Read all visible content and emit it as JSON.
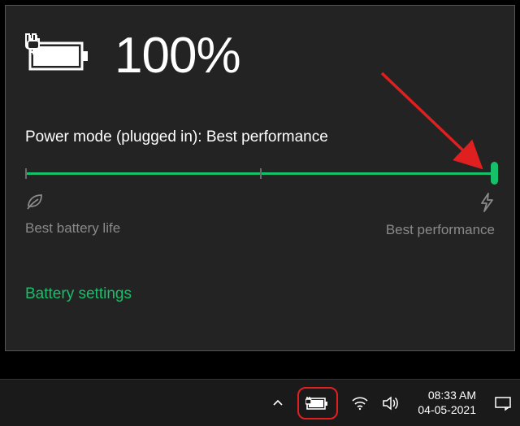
{
  "battery": {
    "percent": "100%",
    "mode_label": "Power mode (plugged in): Best performance",
    "left_label": "Best battery life",
    "right_label": "Best performance",
    "settings_link": "Battery settings"
  },
  "taskbar": {
    "time": "08:33 AM",
    "date": "04-05-2021"
  },
  "colors": {
    "accent": "#16c06a",
    "annotation": "#e02020"
  }
}
